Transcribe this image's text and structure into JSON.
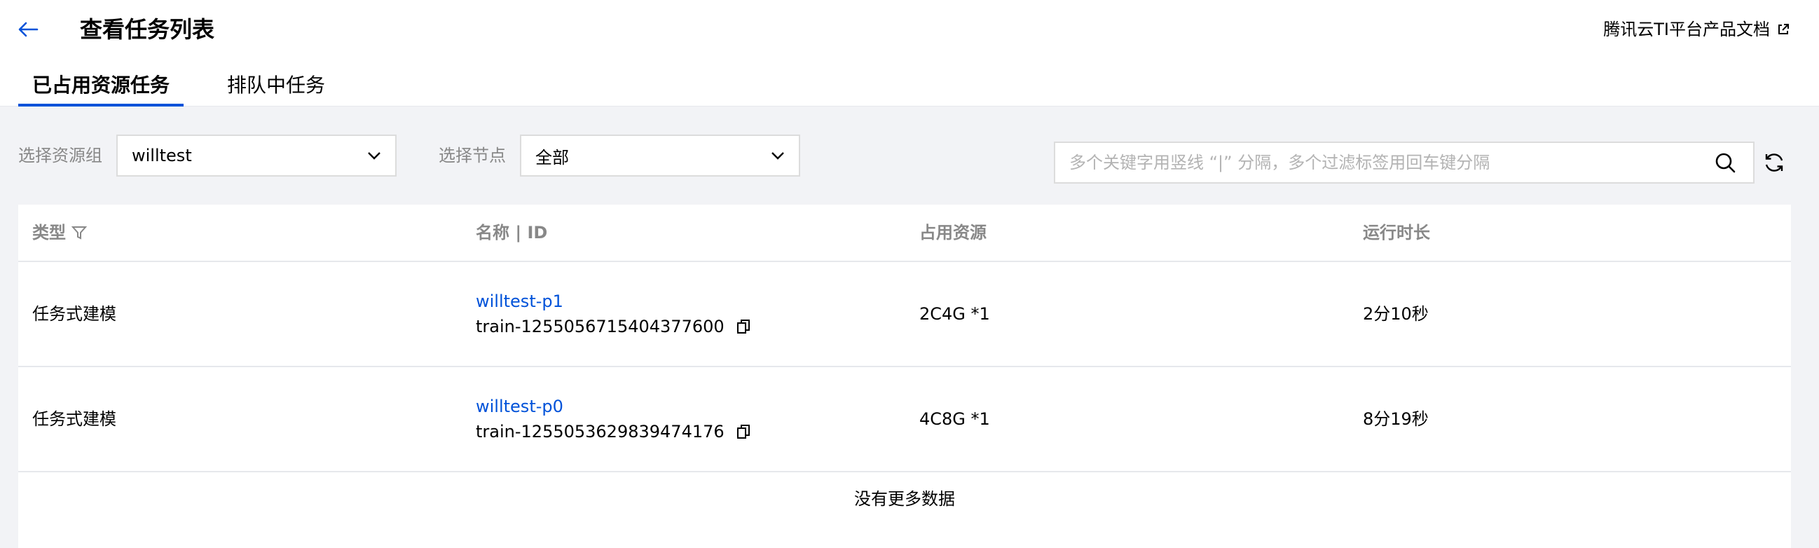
{
  "header": {
    "title": "查看任务列表",
    "doc_link": "腾讯云TI平台产品文档"
  },
  "tabs": [
    {
      "label": "已占用资源任务",
      "active": true
    },
    {
      "label": "排队中任务",
      "active": false
    }
  ],
  "filters": {
    "resource_group_label": "选择资源组",
    "resource_group_value": "willtest",
    "node_label": "选择节点",
    "node_value": "全部",
    "search_placeholder": "多个关键字用竖线 “|” 分隔，多个过滤标签用回车键分隔"
  },
  "table": {
    "columns": [
      "类型",
      "名称 | ID",
      "占用资源",
      "运行时长"
    ],
    "rows": [
      {
        "type": "任务式建模",
        "name": "willtest-p1",
        "id": "train-1255056715404377600",
        "resource": "2C4G *1",
        "duration": "2分10秒"
      },
      {
        "type": "任务式建模",
        "name": "willtest-p0",
        "id": "train-1255053629839474176",
        "resource": "4C8G *1",
        "duration": "8分19秒"
      }
    ],
    "empty_text": "没有更多数据"
  },
  "icons": {
    "back": "arrow-left-icon",
    "external": "external-link-icon",
    "chevron": "chevron-down-icon",
    "search": "search-icon",
    "refresh": "refresh-icon",
    "filter": "filter-icon",
    "copy": "copy-icon"
  },
  "colors": {
    "accent": "#0052d9",
    "muted": "#888888",
    "background": "#f2f3f6"
  }
}
